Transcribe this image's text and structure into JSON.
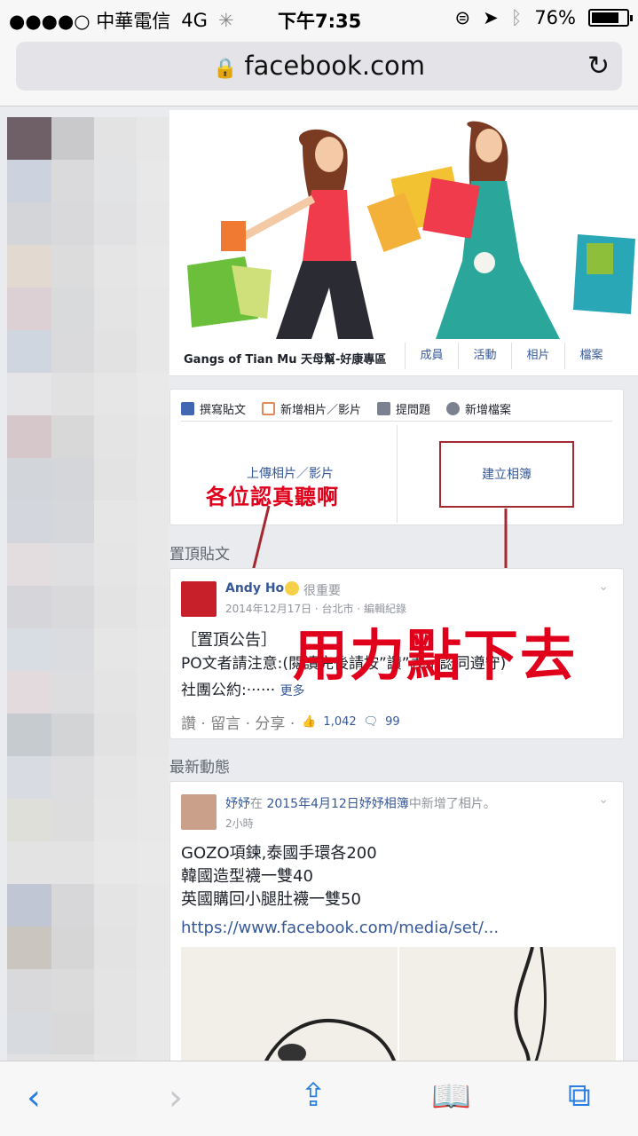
{
  "status_bar": {
    "carrier": "●●●●○ 中華電信",
    "network": "4G",
    "time": "下午7:35",
    "battery": "76%"
  },
  "browser": {
    "url": "facebook.com"
  },
  "sidebar": {
    "cells": [
      "#6f6067",
      "#c9c9cb",
      "#e3e3e4",
      "#e7e7e7",
      "#ccd3df",
      "#dadadc",
      "#e2e3e5",
      "#e8e8e8",
      "#d4d5d9",
      "#d9d9dc",
      "#e1e1e3",
      "#e7e7e7",
      "#e2d9d1",
      "#dcdcdc",
      "#e5e5e5",
      "#e8e8e8",
      "#ddd0d4",
      "#d9dadc",
      "#e4e4e4",
      "#e7e7e7",
      "#d0d6df",
      "#dadadd",
      "#e2e2e3",
      "#e7e7e7",
      "#e5e5e7",
      "#e1e1e2",
      "#e6e6e6",
      "#e9e9e9",
      "#d6c7ca",
      "#d8d8d9",
      "#e4e4e5",
      "#e7e7e7",
      "#d2d5da",
      "#d5d6d9",
      "#e3e3e4",
      "#e7e7e7",
      "#d3d6dd",
      "#d6d7da",
      "#e6e6e6",
      "#e8e8e8",
      "#e4dde0",
      "#dfdfe1",
      "#e5e5e6",
      "#e8e8e8",
      "#d6d6da",
      "#d9d9db",
      "#e3e3e4",
      "#e7e7e7",
      "#d8dde3",
      "#dbdcdf",
      "#e6e6e7",
      "#e8e8e8",
      "#e2dadd",
      "#dddde0",
      "#e4e4e5",
      "#e7e7e7",
      "#c6cbd0",
      "#d3d4d6",
      "#e2e2e3",
      "#e7e7e7",
      "#d9dbe3",
      "#dddde0",
      "#e5e5e6",
      "#e8e8e8",
      "#dedfd8",
      "#dddddd",
      "#e6e6e6",
      "#e8e8e8",
      "#e3e3e3",
      "#e3e3e3",
      "#e8e8e8",
      "#e9e9e9",
      "#c0c6d3",
      "#d7d7d9",
      "#e4e4e4",
      "#e7e7e7",
      "#cbc5c0",
      "#d6d6d7",
      "#e3e3e3",
      "#e7e7e7",
      "#d9d9dc",
      "#dbdbdc",
      "#e4e4e5",
      "#e8e8e8",
      "#d7dbe0",
      "#d9d9da",
      "#e4e4e4",
      "#e8e8e8",
      "#e1e1e3",
      "#e1e1e1",
      "#e6e6e6",
      "#e8e8e8"
    ]
  },
  "group": {
    "name": "Gangs of Tian Mu 天母幫-好康專區",
    "tabs": [
      "成員",
      "活動",
      "相片",
      "檔案"
    ]
  },
  "composer": {
    "tabs": [
      "撰寫貼文",
      "新增相片／影片",
      "提問題",
      "新增檔案"
    ],
    "upload_label": "上傳相片／影片",
    "album_label": "建立相簿"
  },
  "annotations": {
    "note1": "各位認真聽啊",
    "note2": "用力點下去"
  },
  "pinned": {
    "section_title": "置頂貼文",
    "author": "Andy Ho",
    "mood": "很重要",
    "meta": "2014年12月17日 · 台北市 · 編輯紀錄",
    "line1": "［置頂公告］",
    "line2": "PO文者請注意:(閱讀完後請按”讚”表示認同遵守)",
    "line3": "社團公約:······",
    "more": "更多",
    "actions": "讚 · 留言 · 分享 ·",
    "likes": "1,042",
    "comments": "99"
  },
  "feed": {
    "section_title": "最新動態",
    "author": "妤妤",
    "action_pre": "在",
    "album": "2015年4月12日妤妤相簿",
    "action_post": "中新增了相片。",
    "time": "2小時",
    "lines": [
      "GOZO項鍊,泰國手環各200",
      "韓國造型襪一雙40",
      "英國購回小腿肚襪一雙50"
    ],
    "link": "https://www.facebook.com/media/set/..."
  }
}
